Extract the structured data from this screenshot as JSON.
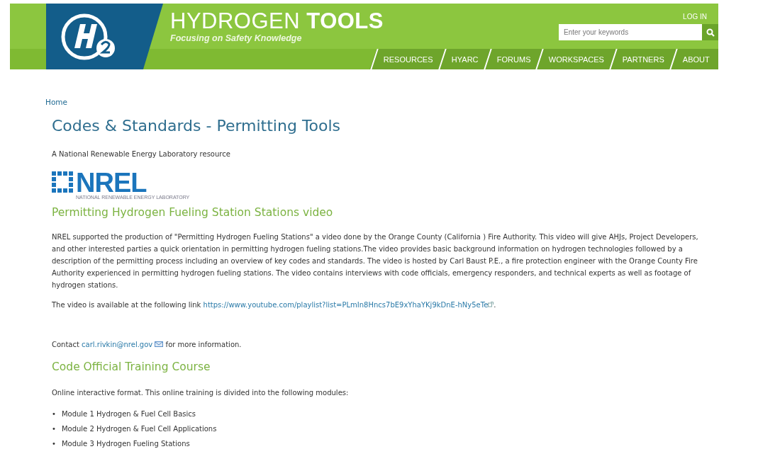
{
  "header": {
    "site_title_light": "HYDROGEN",
    "site_title_bold": "TOOLS",
    "tagline": "Focusing on Safety Knowledge",
    "login": "LOG IN",
    "search": {
      "placeholder": "Enter your keywords"
    },
    "nav": [
      {
        "label": "RESOURCES"
      },
      {
        "label": "HYARC"
      },
      {
        "label": "FORUMS"
      },
      {
        "label": "WORKSPACES"
      },
      {
        "label": "PARTNERS"
      },
      {
        "label": "ABOUT"
      }
    ]
  },
  "breadcrumb": "Home",
  "page_title": "Codes & Standards - Permitting Tools",
  "intro": "A National Renewable Energy Laboratory resource",
  "nrel_logo": {
    "wordmark": "NREL",
    "subtitle": "NATIONAL RENEWABLE ENERGY LABORATORY"
  },
  "sections": [
    {
      "heading": "Permitting Hydrogen Fueling Station Stations video",
      "paragraph": "NREL supported the production of \"Permitting Hydrogen Fueling Stations\"  a video done by  the Orange County  (California ) Fire Authority.    This video will give AHJs, Project Developers, and other interested parties a quick orientation in permitting hydrogen fueling stations.The video provides basic background information on hydrogen technologies followed by a description of the permitting process including an overview of key codes and standards.  The video is hosted by Carl Baust P.E., a fire protection engineer with  the Orange County Fire Authority experienced in permitting hydrogen fueling stations.  The video contains interviews with code officials, emergency responders, and technical experts as well as footage of hydrogen stations.",
      "link_text": "The video is available at the following link",
      "link": "https://www.youtube.com/playlist?list=PLmIn8Hncs7bE9xYhaYKj9kDnE-hNy5eTe",
      "link_end": ".",
      "contact_prefix": "Contact",
      "contact_email": "carl.rivkin@nrel.gov",
      "contact_suffix": "for more information."
    },
    {
      "heading": "Code Official Training Course",
      "paragraph": "Online interactive format. This online training is divided into the following modules:",
      "modules": [
        {
          "bullet": "•",
          "text": "Module 1 Hydrogen & Fuel Cell Basics"
        },
        {
          "bullet": "•",
          "text": "Module 2  Hydrogen & Fuel Cell Applications"
        },
        {
          "bullet": "•",
          "text": "Module 3 Hydrogen Fueling Stations"
        }
      ]
    }
  ]
}
